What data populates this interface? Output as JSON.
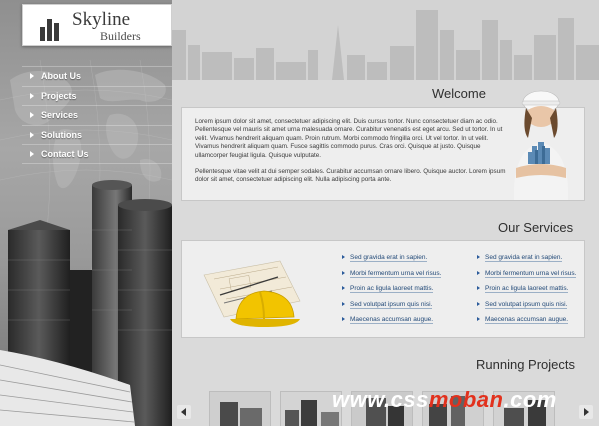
{
  "brand": {
    "title": "Skyline",
    "subtitle": "Builders"
  },
  "nav": [
    {
      "label": "About Us"
    },
    {
      "label": "Projects"
    },
    {
      "label": "Services"
    },
    {
      "label": "Solutions"
    },
    {
      "label": "Contact Us"
    }
  ],
  "welcome": {
    "title": "Welcome",
    "paragraph1": "Lorem ipsum dolor sit amet, consectetuer adipiscing elit. Duis cursus tortor. Nunc consectetuer diam ac odio. Pellentesque vel mauris sit amet urna malesuada ornare. Curabitur venenatis est eget arcu. Sed ut tortor. In ut velit. Vivamus hendrerit aliquam quam. Proin rutrum. Morbi commodo fringilla orci. Ut vel tortor. In ut velit. Vivamus hendrerit aliquam quam. Fusce sagittis commodo purus. Cras orci. Quisque at justo. Quisque ullamcorper feugiat ligula. Quisque vulputate.",
    "paragraph2": "Pellentesque vitae velit at dui semper sodales. Curabitur accumsan ornare libero. Quisque auctor. Lorem ipsum dolor sit amet, consectetuer adipiscing elit. Nulla adipiscing porta ante."
  },
  "services": {
    "title": "Our Services",
    "col1": [
      "Sed gravida erat in sapien.",
      "Morbi fermentum urna vel risus.",
      "Proin ac ligula laoreet mattis.",
      "Sed volutpat ipsum quis nisi.",
      "Maecenas accumsan augue."
    ],
    "col2": [
      "Sed gravida erat in sapien.",
      "Morbi fermentum urna vel risus.",
      "Proin ac ligula laoreet mattis.",
      "Sed volutpat ipsum quis nisi.",
      "Maecenas accumsan augue."
    ]
  },
  "projects": {
    "title": "Running Projects"
  },
  "watermark": {
    "pre": "www.css",
    "accent": "moban",
    "post": ".com"
  },
  "colors": {
    "link": "#234a78",
    "accent": "#e2311d",
    "sidebar": "#9a9a9a"
  }
}
